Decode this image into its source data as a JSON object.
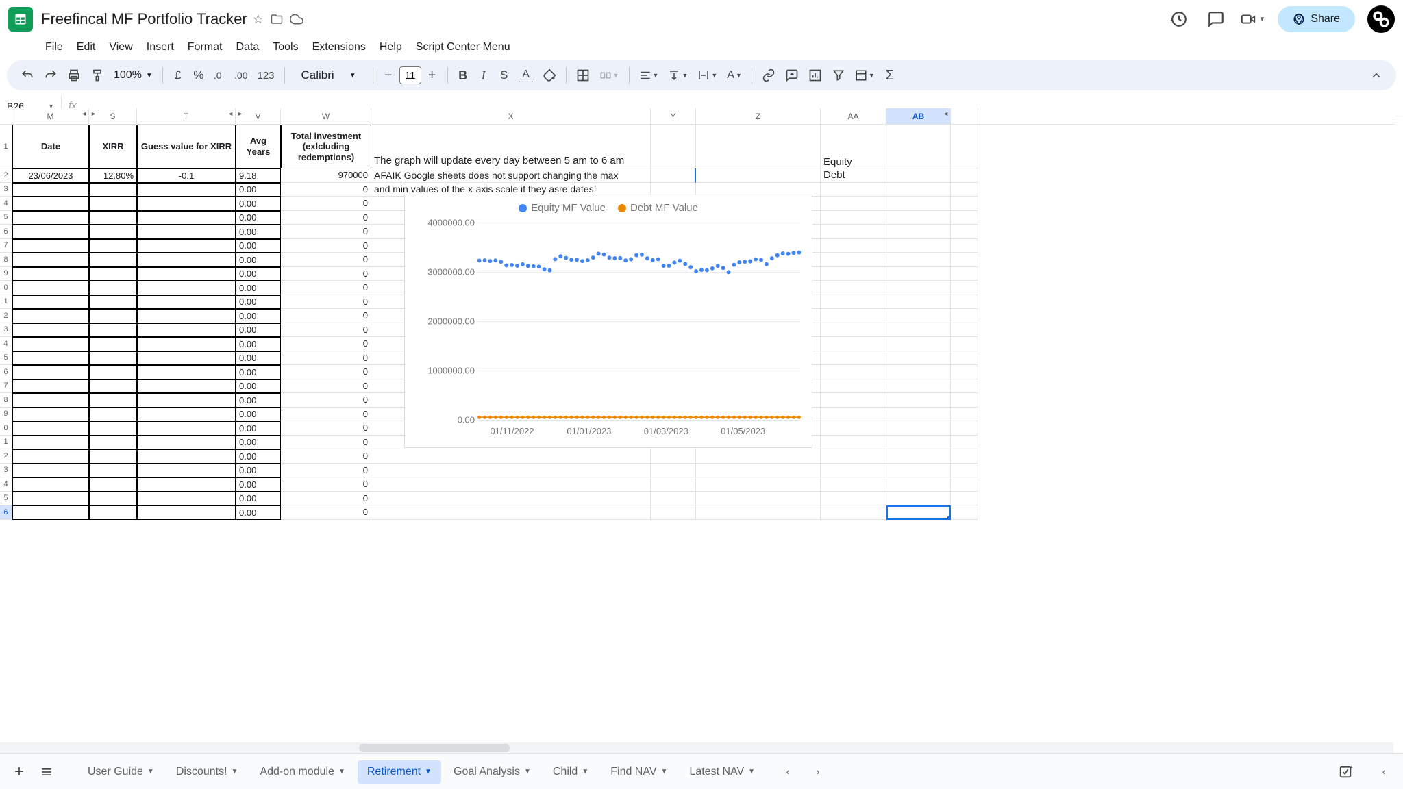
{
  "doc": {
    "title": "Freefincal MF Portfolio Tracker"
  },
  "menus": [
    "File",
    "Edit",
    "View",
    "Insert",
    "Format",
    "Data",
    "Tools",
    "Extensions",
    "Help",
    "Script Center Menu"
  ],
  "toolbar": {
    "zoom": "100%",
    "font": "Calibri",
    "font_size": "11"
  },
  "name_box": "B26",
  "share_label": "Share",
  "columns": [
    "M",
    "S",
    "T",
    "V",
    "W",
    "X",
    "Y",
    "Z",
    "AA",
    "AB"
  ],
  "headers": {
    "M": "Date",
    "S": "XIRR",
    "T": "Guess value for XIRR",
    "V": "Avg Years",
    "W": "Total investment (exlcluding redemptions)"
  },
  "row_labels": [
    "1",
    "2",
    "3",
    "4",
    "5",
    "6",
    "7",
    "8",
    "9",
    "0",
    "1",
    "2",
    "3",
    "4",
    "5",
    "6",
    "7",
    "8",
    "9",
    "0",
    "1",
    "2",
    "3",
    "4",
    "5",
    "6"
  ],
  "data_row2": {
    "M": "23/06/2023",
    "S": "12.80%",
    "T": "-0.1",
    "V": "9.18",
    "W": "970000"
  },
  "v_fill": "0.00",
  "w_fill": "0",
  "x_text1": "The graph will update every day between 5 am to 6 am",
  "x_text2": "AFAIK Google sheets does not support changing the max",
  "x_text3": "and min values of the x-axis scale if they asre dates!",
  "aa_text1": "Equity",
  "aa_text2": "Debt",
  "sheet_tabs": [
    "User Guide",
    "Discounts!",
    "Add-on module",
    "Retirement",
    "Goal Analysis",
    "Child",
    "Find NAV",
    "Latest NAV"
  ],
  "active_tab": "Retirement",
  "chart_data": {
    "type": "line",
    "series": [
      {
        "name": "Equity MF Value",
        "color": "#4285f4",
        "x": [
          "01/10/2022",
          "01/11/2022",
          "01/12/2022",
          "01/01/2023",
          "01/02/2023",
          "01/03/2023",
          "01/04/2023",
          "01/05/2023",
          "01/06/2023"
        ],
        "values": [
          3200000,
          3100000,
          3250000,
          3300000,
          3280000,
          3150000,
          3050000,
          3200000,
          3350000
        ]
      },
      {
        "name": "Debt MF Value",
        "color": "#ea8600",
        "x": [
          "01/10/2022",
          "01/11/2022",
          "01/12/2022",
          "01/01/2023",
          "01/02/2023",
          "01/03/2023",
          "01/04/2023",
          "01/05/2023",
          "01/06/2023"
        ],
        "values": [
          50000,
          50000,
          50000,
          50000,
          50000,
          50000,
          50000,
          50000,
          50000
        ]
      }
    ],
    "ylim": [
      0,
      4000000
    ],
    "ytick_labels": [
      "0.00",
      "1000000.00",
      "2000000.00",
      "3000000.00",
      "4000000.00"
    ],
    "xtick_labels": [
      "01/11/2022",
      "01/01/2023",
      "01/03/2023",
      "01/05/2023"
    ]
  }
}
